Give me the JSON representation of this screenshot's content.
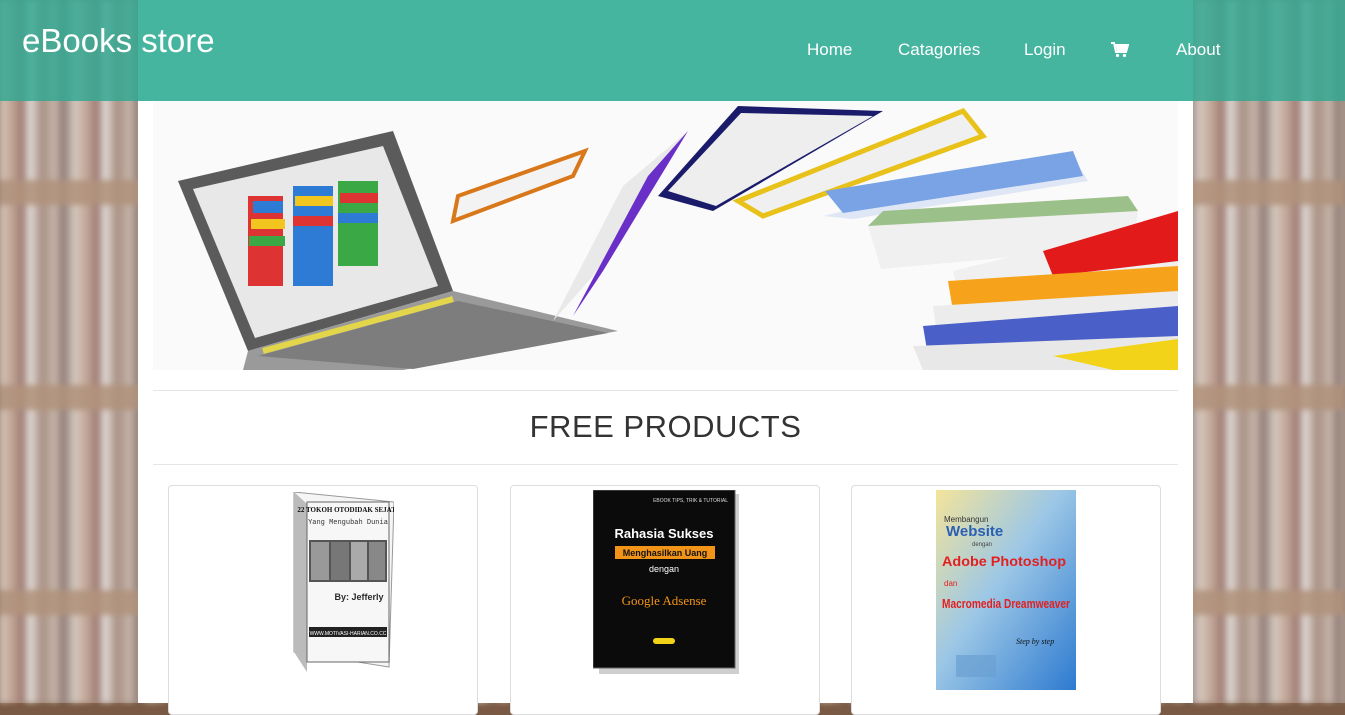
{
  "navbar": {
    "brand": "eBooks store",
    "links": [
      {
        "label": "Home"
      },
      {
        "label": "Catagories"
      },
      {
        "label": "Login"
      },
      {
        "label": "About"
      }
    ],
    "cart_icon": "shopping-cart-icon"
  },
  "colors": {
    "navbar": "#45b5a0",
    "background": "#ffffff"
  },
  "section": {
    "title": "FREE PRODUCTS"
  },
  "products": [
    {
      "cover_lines": [
        "22 TOKOH OTODIDAK SEJATI",
        "Yang Mengubah Dunia",
        "By: Jefferly",
        "WWW.MOTIVASI-HARIAN.CO.CC"
      ]
    },
    {
      "cover_lines": [
        "EBOOK TIPS, TRIK & TUTORIAL",
        "Rahasia Sukses",
        "Menghasilkan Uang",
        "dengan",
        "Google Adsense"
      ]
    },
    {
      "cover_lines": [
        "Membangun",
        "Website",
        "dengan",
        "Adobe Photoshop",
        "dan",
        "Macromedia Dreamweaver",
        "Step by step"
      ]
    }
  ]
}
